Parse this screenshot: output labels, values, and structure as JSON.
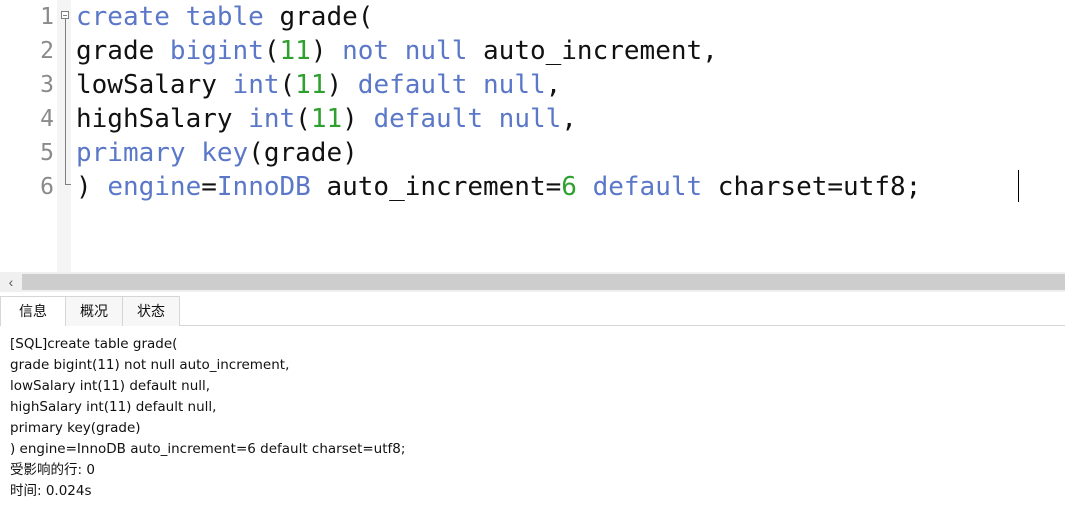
{
  "editor": {
    "line_numbers": [
      "1",
      "2",
      "3",
      "4",
      "5",
      "6"
    ],
    "lines": [
      [
        {
          "t": "create table",
          "c": "kw"
        },
        {
          "t": " grade(",
          "c": "plain"
        }
      ],
      [
        {
          "t": "grade ",
          "c": "plain"
        },
        {
          "t": "bigint",
          "c": "kw"
        },
        {
          "t": "(",
          "c": "plain"
        },
        {
          "t": "11",
          "c": "num"
        },
        {
          "t": ") ",
          "c": "plain"
        },
        {
          "t": "not null",
          "c": "kw"
        },
        {
          "t": " auto_increment,",
          "c": "plain"
        }
      ],
      [
        {
          "t": "lowSalary ",
          "c": "plain"
        },
        {
          "t": "int",
          "c": "kw"
        },
        {
          "t": "(",
          "c": "plain"
        },
        {
          "t": "11",
          "c": "num"
        },
        {
          "t": ") ",
          "c": "plain"
        },
        {
          "t": "default null",
          "c": "kw"
        },
        {
          "t": ",",
          "c": "plain"
        }
      ],
      [
        {
          "t": "highSalary ",
          "c": "plain"
        },
        {
          "t": "int",
          "c": "kw"
        },
        {
          "t": "(",
          "c": "plain"
        },
        {
          "t": "11",
          "c": "num"
        },
        {
          "t": ") ",
          "c": "plain"
        },
        {
          "t": "default null",
          "c": "kw"
        },
        {
          "t": ",",
          "c": "plain"
        }
      ],
      [
        {
          "t": "primary key",
          "c": "kw"
        },
        {
          "t": "(grade)",
          "c": "plain"
        }
      ],
      [
        {
          "t": ") ",
          "c": "plain"
        },
        {
          "t": "engine",
          "c": "kw"
        },
        {
          "t": "=",
          "c": "plain"
        },
        {
          "t": "InnoDB",
          "c": "kw"
        },
        {
          "t": " auto_increment=",
          "c": "plain"
        },
        {
          "t": "6",
          "c": "num"
        },
        {
          "t": " ",
          "c": "plain"
        },
        {
          "t": "default",
          "c": "kw"
        },
        {
          "t": " charset=utf8;",
          "c": "plain"
        }
      ]
    ]
  },
  "scrollbar": {
    "left_arrow": "‹"
  },
  "tabs": [
    {
      "label": "信息",
      "active": true
    },
    {
      "label": "概况",
      "active": false
    },
    {
      "label": "状态",
      "active": false
    }
  ],
  "messages": [
    "[SQL]create table grade(",
    "grade bigint(11) not null auto_increment,",
    "lowSalary int(11) default null,",
    "highSalary int(11) default null,",
    "primary key(grade)",
    ") engine=InnoDB auto_increment=6 default charset=utf8;",
    "受影响的行: 0",
    "时间: 0.024s"
  ],
  "colors": {
    "keyword": "#5b78c8",
    "number": "#2ea02e",
    "text": "#111111",
    "line_number": "#8a8a8a"
  }
}
